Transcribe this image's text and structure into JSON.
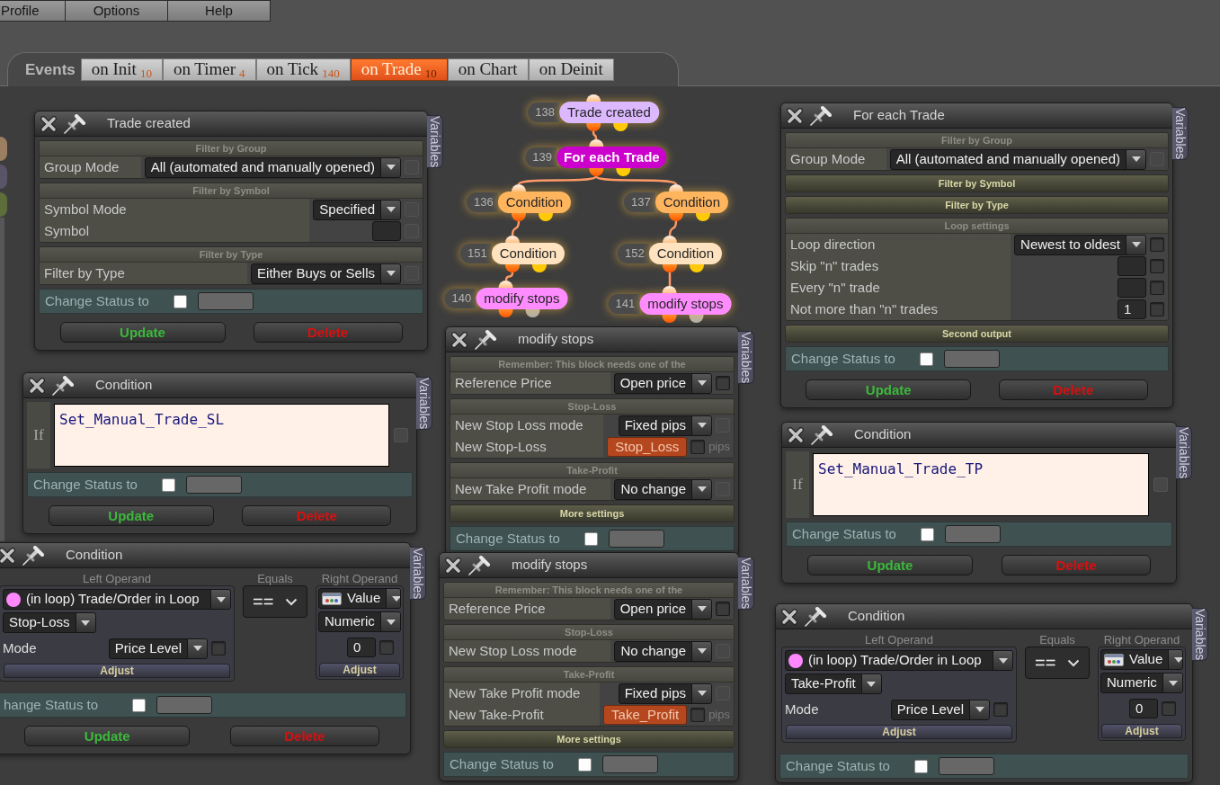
{
  "menu": [
    {
      "label": "Profile"
    },
    {
      "label": "Options"
    },
    {
      "label": "Help"
    }
  ],
  "events": {
    "label": "Events",
    "tabs": [
      {
        "label": "on Init",
        "count": "10",
        "selected": false
      },
      {
        "label": "on Timer",
        "count": "4",
        "selected": false
      },
      {
        "label": "on Tick",
        "count": "140",
        "selected": false
      },
      {
        "label": "on Trade",
        "count": "10",
        "selected": true
      },
      {
        "label": "on Chart",
        "selected": false
      },
      {
        "label": "on Deinit",
        "selected": false
      }
    ]
  },
  "graph": {
    "nodes": [
      {
        "number": "138",
        "label": "Trade created",
        "kind": "event",
        "color": "#dcb8ff",
        "children": [
          {
            "number": "139",
            "label": "For each Trade",
            "kind": "loop",
            "color": "#cc00cc",
            "children": [
              {
                "number": "136",
                "label": "Condition",
                "kind": "condition",
                "color": "#ffb45e",
                "children": [
                  {
                    "number": "151",
                    "label": "Condition",
                    "kind": "condition",
                    "color": "#ffe3c0",
                    "children": [
                      {
                        "number": "140",
                        "label": "modify stops",
                        "kind": "action",
                        "color": "#ff8cff"
                      }
                    ]
                  }
                ]
              },
              {
                "number": "137",
                "label": "Condition",
                "kind": "condition",
                "color": "#ffb45e",
                "children": [
                  {
                    "number": "152",
                    "label": "Condition",
                    "kind": "condition",
                    "color": "#ffe3c0",
                    "children": [
                      {
                        "number": "141",
                        "label": "modify stops",
                        "kind": "action",
                        "color": "#ff8cff"
                      }
                    ]
                  }
                ]
              }
            ]
          }
        ]
      }
    ]
  },
  "panels": [
    {
      "kind": "form",
      "title": "Trade created",
      "side_tab": "Variables",
      "sections": [
        {
          "title": "Filter by Group",
          "expanded": true,
          "rows": [
            {
              "kind": "select",
              "label": "Group Mode",
              "value": "All (automated and manually opened)",
              "checkbox": {
                "checked": false,
                "disabled": true
              }
            }
          ]
        },
        {
          "title": "Filter by Symbol",
          "expanded": true,
          "rows": [
            {
              "kind": "select",
              "label": "Symbol Mode",
              "value": "Specified",
              "checkbox": {
                "checked": false,
                "disabled": true
              }
            },
            {
              "kind": "input",
              "label": "Symbol",
              "checkbox": {
                "checked": false,
                "disabled": true
              }
            }
          ]
        },
        {
          "title": "Filter by Type",
          "expanded": true,
          "rows": [
            {
              "kind": "select",
              "label": "Filter by Type",
              "value": "Either Buys or Sells",
              "checkbox": {
                "checked": false,
                "disabled": true
              }
            }
          ]
        }
      ],
      "status": {
        "label": "Change Status to",
        "checked": false
      },
      "buttons": [
        {
          "kind": "update",
          "label": "Update"
        },
        {
          "kind": "delete",
          "label": "Delete"
        }
      ]
    },
    {
      "kind": "form",
      "title": "For each Trade",
      "side_tab": "Variables",
      "sections": [
        {
          "title": "Filter by Group",
          "expanded": true,
          "rows": [
            {
              "kind": "select",
              "label": "Group Mode",
              "value": "All (automated and manually opened)",
              "checkbox": {
                "checked": false,
                "disabled": true
              }
            }
          ]
        },
        {
          "title": "Filter by Symbol",
          "expanded": false
        },
        {
          "title": "Filter by Type",
          "expanded": false
        },
        {
          "title": "Loop settings",
          "expanded": true,
          "rows": [
            {
              "kind": "select",
              "label": "Loop direction",
              "value": "Newest to oldest",
              "checkbox": {
                "checked": false,
                "disabled": false
              }
            },
            {
              "kind": "input",
              "label": "Skip \"n\" trades",
              "checkbox": {
                "checked": false,
                "disabled": false
              }
            },
            {
              "kind": "input",
              "label": "Every \"n\" trade",
              "checkbox": {
                "checked": false,
                "disabled": false
              }
            },
            {
              "kind": "input",
              "label": "Not more than \"n\" trades",
              "value": "1",
              "checkbox": {
                "checked": false,
                "disabled": false
              }
            }
          ]
        },
        {
          "title": "Second output",
          "expanded": false
        }
      ],
      "status": {
        "label": "Change Status to",
        "checked": false
      },
      "buttons": [
        {
          "kind": "update",
          "label": "Update"
        },
        {
          "kind": "delete",
          "label": "Delete"
        }
      ]
    },
    {
      "kind": "form",
      "title": "modify stops",
      "side_tab": "Variables",
      "sections": [
        {
          "title": "Remember: This block needs one of the",
          "expanded": true,
          "rows": [
            {
              "kind": "select",
              "label": "Reference Price",
              "value": "Open price",
              "checkbox": {
                "checked": false,
                "disabled": false
              }
            }
          ]
        },
        {
          "title": "Stop-Loss",
          "expanded": true,
          "rows": [
            {
              "kind": "select",
              "label": "New Stop Loss mode",
              "value": "Fixed pips",
              "checkbox": {
                "checked": false,
                "disabled": true
              }
            },
            {
              "kind": "variable",
              "label": "New Stop-Loss",
              "value": "Stop_Loss",
              "checkbox": {
                "checked": false,
                "disabled": false
              },
              "unit": "pips"
            }
          ]
        },
        {
          "title": "Take-Profit",
          "expanded": true,
          "rows": [
            {
              "kind": "select",
              "label": "New Take Profit mode",
              "value": "No change",
              "checkbox": {
                "checked": false,
                "disabled": true
              }
            }
          ]
        },
        {
          "title": "More settings",
          "expanded": false
        }
      ],
      "status": {
        "label": "Change Status to",
        "checked": false
      }
    },
    {
      "kind": "formula",
      "title": "Condition",
      "side_tab": "Variables",
      "label": "If",
      "formula": "Set_Manual_Trade_SL",
      "checkbox": {
        "checked": false,
        "disabled": true
      },
      "status": {
        "label": "Change Status to",
        "checked": false
      },
      "buttons": [
        {
          "kind": "update",
          "label": "Update"
        },
        {
          "kind": "delete",
          "label": "Delete"
        }
      ]
    },
    {
      "kind": "formula",
      "title": "Condition",
      "side_tab": "Variables",
      "label": "If",
      "formula": "Set_Manual_Trade_TP",
      "checkbox": {
        "checked": false,
        "disabled": true
      },
      "status": {
        "label": "Change Status to",
        "checked": false
      },
      "buttons": [
        {
          "kind": "update",
          "label": "Update"
        },
        {
          "kind": "delete",
          "label": "Delete"
        }
      ]
    },
    {
      "kind": "compare",
      "title": "Condition",
      "side_tab": "Variables",
      "left": {
        "heading": "Left Operand",
        "source": "(in loop) Trade/Order in Loop",
        "property": "Stop-Loss",
        "mode_label": "Mode",
        "mode": "Price Level",
        "checkbox": {
          "checked": false,
          "disabled": false
        },
        "adjust": "Adjust"
      },
      "operator": {
        "heading": "Equals",
        "value": "=="
      },
      "right": {
        "heading": "Right Operand",
        "source": "Value",
        "type": "Numeric",
        "value": "0",
        "checkbox": {
          "checked": false,
          "disabled": false
        },
        "adjust": "Adjust"
      },
      "status": {
        "label": "hange Status to",
        "checked": false
      },
      "buttons": [
        {
          "kind": "update",
          "label": "Update"
        },
        {
          "kind": "delete",
          "label": "Delete"
        }
      ]
    },
    {
      "kind": "form",
      "title": "modify stops",
      "side_tab": "Variables",
      "sections": [
        {
          "title": "Remember: This block needs one of the",
          "expanded": true,
          "rows": [
            {
              "kind": "select",
              "label": "Reference Price",
              "value": "Open price",
              "checkbox": {
                "checked": false,
                "disabled": false
              }
            }
          ]
        },
        {
          "title": "Stop-Loss",
          "expanded": true,
          "rows": [
            {
              "kind": "select",
              "label": "New Stop Loss mode",
              "value": "No change",
              "checkbox": {
                "checked": false,
                "disabled": true
              }
            }
          ]
        },
        {
          "title": "Take-Profit",
          "expanded": true,
          "rows": [
            {
              "kind": "select",
              "label": "New Take Profit mode",
              "value": "Fixed pips",
              "checkbox": {
                "checked": false,
                "disabled": true
              }
            },
            {
              "kind": "variable",
              "label": "New Take-Profit",
              "value": "Take_Profit",
              "checkbox": {
                "checked": false,
                "disabled": false
              },
              "unit": "pips"
            }
          ]
        },
        {
          "title": "More settings",
          "expanded": false
        }
      ],
      "status": {
        "label": "Change Status to",
        "checked": false
      }
    },
    {
      "kind": "compare",
      "title": "Condition",
      "side_tab": "Variables",
      "left": {
        "heading": "Left Operand",
        "source": "(in loop) Trade/Order in Loop",
        "property": "Take-Profit",
        "mode_label": "Mode",
        "mode": "Price Level",
        "checkbox": {
          "checked": false,
          "disabled": false
        },
        "adjust": "Adjust"
      },
      "operator": {
        "heading": "Equals",
        "value": "=="
      },
      "right": {
        "heading": "Right Operand",
        "source": "Value",
        "type": "Numeric",
        "value": "0",
        "checkbox": {
          "checked": false,
          "disabled": false
        },
        "adjust": "Adjust"
      },
      "status": {
        "label": "Change Status to",
        "checked": false
      }
    }
  ]
}
